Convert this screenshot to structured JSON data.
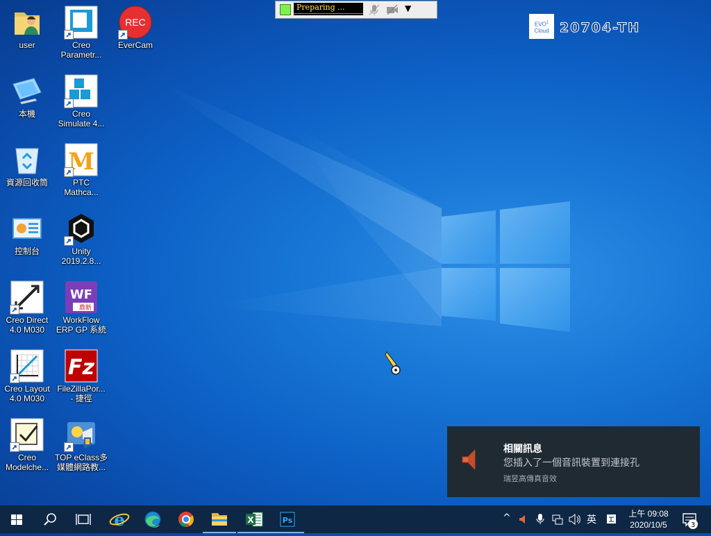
{
  "desktop": {
    "icons": [
      {
        "label": "user",
        "icon": "user-folder-icon"
      },
      {
        "label": "Creo\nParametr...",
        "icon": "creo-parametric-icon"
      },
      {
        "label": "EverCam",
        "icon": "evercam-rec-icon",
        "rec_text": "REC"
      },
      {
        "label": "本機",
        "icon": "this-pc-icon"
      },
      {
        "label": "Creo\nSimulate 4...",
        "icon": "creo-simulate-icon"
      },
      {
        "label": "資源回收筒",
        "icon": "recycle-bin-icon"
      },
      {
        "label": "PTC\nMathca...",
        "icon": "ptc-mathcad-icon"
      },
      {
        "label": "控制台",
        "icon": "control-panel-icon"
      },
      {
        "label": "Unity\n2019.2.8...",
        "icon": "unity-icon"
      },
      {
        "label": "Creo Direct\n4.0 M030",
        "icon": "creo-direct-icon"
      },
      {
        "label": "WorkFlow\nERP GP 系統",
        "icon": "workflow-erp-icon",
        "badge_text": "WF",
        "sub_text": "鼎新"
      },
      {
        "label": "Creo Layout\n4.0 M030",
        "icon": "creo-layout-icon"
      },
      {
        "label": "FileZillaPor...\n- 捷徑",
        "icon": "filezilla-icon"
      },
      {
        "label": "Creo\nModelche...",
        "icon": "creo-modelcheck-icon"
      },
      {
        "label": "TOP eClass多\n媒體網路教...",
        "icon": "top-eclass-icon"
      }
    ]
  },
  "recorder_toolbar": {
    "status_text": "Preparing ...",
    "indicator_color": "#7CF24A",
    "icons": [
      "microphone-muted-icon",
      "camera-muted-icon",
      "dropdown-arrow-icon"
    ],
    "dropdown_glyph": "▼"
  },
  "machine_label": {
    "badge_line1": "EVO",
    "badge_line2": "Cloud",
    "badge_sup": "1",
    "name": "20704-TH"
  },
  "notification": {
    "icon": "speaker-icon",
    "title": "相關訊息",
    "message": "您插入了一個音訊裝置到連接孔",
    "source": "瑞昱高傳真音效"
  },
  "taskbar": {
    "start_icon": "windows-start-icon",
    "pinned": [
      {
        "name": "search",
        "icon": "search-icon"
      },
      {
        "name": "task-view",
        "icon": "task-view-icon"
      },
      {
        "name": "internet-explorer",
        "icon": "internet-explorer-icon"
      },
      {
        "name": "edge",
        "icon": "edge-icon"
      },
      {
        "name": "chrome",
        "icon": "chrome-icon"
      },
      {
        "name": "file-explorer",
        "icon": "file-explorer-icon"
      },
      {
        "name": "excel",
        "icon": "excel-icon",
        "text": "X"
      },
      {
        "name": "photoshop",
        "icon": "photoshop-icon",
        "text": "Ps"
      }
    ],
    "tray": {
      "chevron": "^",
      "ime_label": "英",
      "time": "上午 09:08",
      "date": "2020/10/5",
      "notification_count": "3"
    }
  },
  "colors": {
    "desktop_blue": "#0C5FC4",
    "taskbar": "#0E2744",
    "toast_bg": "#1F2A33",
    "excel_green": "#1D7044",
    "photoshop_navy": "#001E36",
    "evercam_red": "#E53030"
  }
}
